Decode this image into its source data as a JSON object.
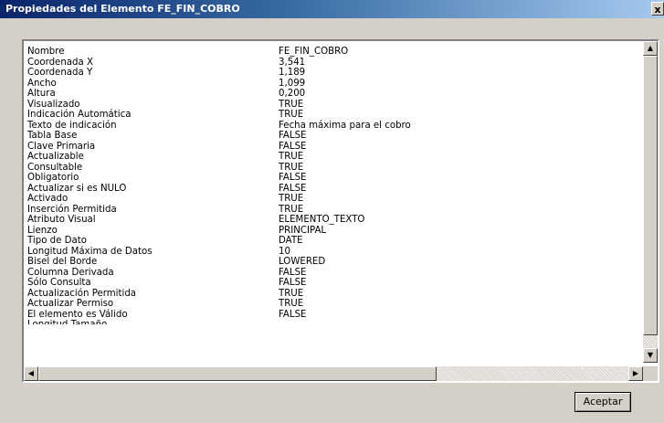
{
  "window": {
    "title": "Propiedades del Elemento FE_FIN_COBRO",
    "close_glyph": "x"
  },
  "properties": [
    {
      "name": "Nombre",
      "value": "FE_FIN_COBRO"
    },
    {
      "name": "Coordenada X",
      "value": "3,541"
    },
    {
      "name": "Coordenada Y",
      "value": "1,189"
    },
    {
      "name": "Ancho",
      "value": "1,099"
    },
    {
      "name": "Altura",
      "value": "0,200"
    },
    {
      "name": "Visualizado",
      "value": "TRUE"
    },
    {
      "name": "Indicación Automática",
      "value": "TRUE"
    },
    {
      "name": "Texto de indicación",
      "value": "Fecha máxima para el cobro"
    },
    {
      "name": "Tabla Base",
      "value": "FALSE"
    },
    {
      "name": "Clave Primaria",
      "value": "FALSE"
    },
    {
      "name": "Actualizable",
      "value": "TRUE"
    },
    {
      "name": "Consultable",
      "value": "TRUE"
    },
    {
      "name": "Obligatorio",
      "value": "FALSE"
    },
    {
      "name": "Actualizar si es NULO",
      "value": "FALSE"
    },
    {
      "name": "Activado",
      "value": "TRUE"
    },
    {
      "name": "Inserción Permitida",
      "value": "TRUE"
    },
    {
      "name": "Atributo Visual",
      "value": "ELEMENTO_TEXTO"
    },
    {
      "name": "Lienzo",
      "value": "PRINCIPAL"
    },
    {
      "name": "Tipo de Dato",
      "value": "DATE"
    },
    {
      "name": "Longitud Máxima de Datos",
      "value": "10"
    },
    {
      "name": "Bisel del Borde",
      "value": "LOWERED"
    },
    {
      "name": "Columna Derivada",
      "value": "FALSE"
    },
    {
      "name": "Sólo Consulta",
      "value": "FALSE"
    },
    {
      "name": "Actualización Permitida",
      "value": "TRUE"
    },
    {
      "name": "Actualizar Permiso",
      "value": "TRUE"
    },
    {
      "name": "El elemento es Válido",
      "value": "FALSE"
    },
    {
      "name": "Longitud Tamaño",
      "value": ""
    }
  ],
  "scrollbar": {
    "up_glyph": "▲",
    "down_glyph": "▼",
    "left_glyph": "◀",
    "right_glyph": "▶"
  },
  "buttons": {
    "accept_label": "Aceptar"
  }
}
